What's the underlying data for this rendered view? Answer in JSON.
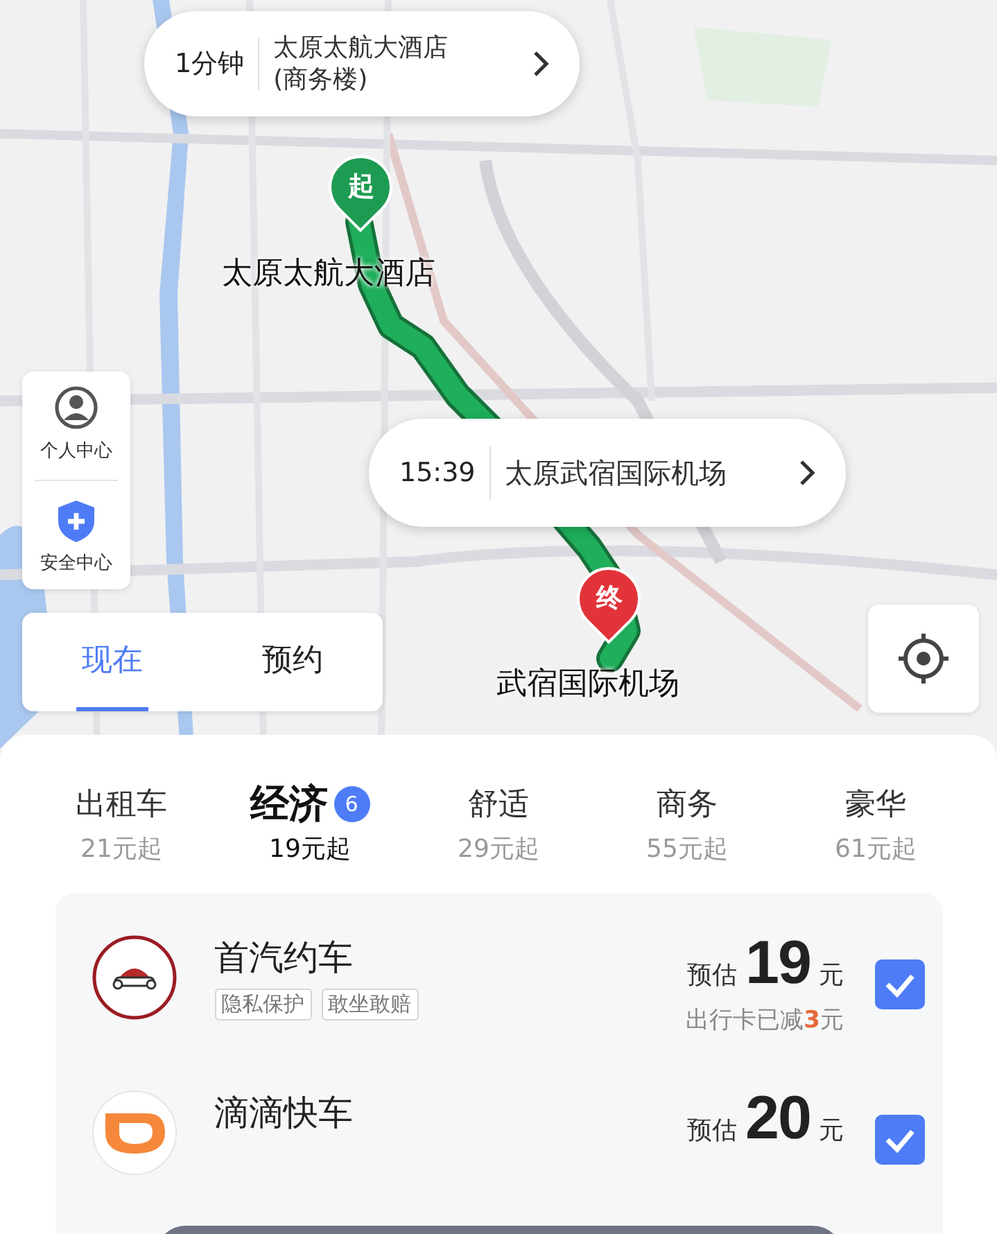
{
  "origin_callout": {
    "eta": "1分钟",
    "name": "太原太航大酒店",
    "detail": "(商务楼)"
  },
  "origin_marker": {
    "label": "起"
  },
  "origin_label": "太原太航大酒店",
  "destination_callout": {
    "time": "15:39",
    "name": "太原武宿国际机场"
  },
  "destination_marker": {
    "label": "终"
  },
  "destination_label": "武宿国际机场",
  "side_buttons": [
    {
      "kind": "person",
      "label": "个人中心"
    },
    {
      "kind": "shield",
      "label": "安全中心"
    }
  ],
  "time_tabs": [
    {
      "label": "现在",
      "selected": true
    },
    {
      "label": "预约",
      "selected": false
    }
  ],
  "car_classes": [
    {
      "name": "出租车",
      "price": "21元起",
      "selected": false
    },
    {
      "name": "经济",
      "price": "19元起",
      "selected": true,
      "badge": "6"
    },
    {
      "name": "舒适",
      "price": "29元起",
      "selected": false
    },
    {
      "name": "商务",
      "price": "55元起",
      "selected": false
    },
    {
      "name": "豪华",
      "price": "61元起",
      "selected": false
    }
  ],
  "options": [
    {
      "kind": "shouqi",
      "name": "首汽约车",
      "tags": [
        "隐私保护",
        "敢坐敢赔"
      ],
      "prefix": "预估",
      "price": "19",
      "unit": "元",
      "discount": "出行卡已减**3**元",
      "checked": true
    },
    {
      "kind": "didi",
      "name": "滴滴快车",
      "prefix": "预估",
      "price": "20",
      "unit": "元",
      "checked": true
    }
  ]
}
